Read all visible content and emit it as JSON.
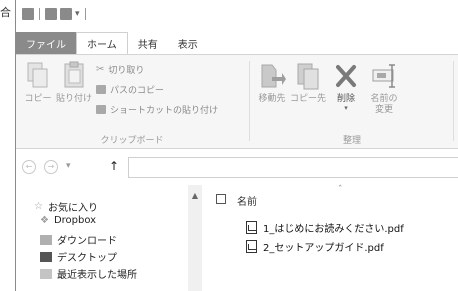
{
  "left_char": "合",
  "ribbon": {
    "tabs": {
      "file": "ファイル",
      "home": "ホーム",
      "share": "共有",
      "view": "表示"
    },
    "clipboard": {
      "copy": "コピー",
      "paste": "貼り付け",
      "cut": "切り取り",
      "copy_path": "パスのコピー",
      "paste_shortcut": "ショートカットの貼り付け",
      "group_label": "クリップボード"
    },
    "organize": {
      "move_to": "移動先",
      "copy_to": "コピー先",
      "delete": "削除",
      "rename_line1": "名前の",
      "rename_line2": "変更",
      "group_label": "整理"
    }
  },
  "nav_pane": {
    "items": [
      {
        "label": "お気に入り",
        "icon": "star-icon"
      },
      {
        "label": "Dropbox",
        "icon": "dropbox-icon"
      },
      {
        "label": "ダウンロード",
        "icon": "download-icon"
      },
      {
        "label": "デスクトップ",
        "icon": "desktop-icon"
      },
      {
        "label": "最近表示した場所",
        "icon": "recent-places-icon"
      }
    ]
  },
  "content": {
    "column_name": "名前",
    "files": [
      {
        "name": "1_はじめにお読みください.pdf",
        "icon": "pdf-file-icon"
      },
      {
        "name": "2_セットアップガイド.pdf",
        "icon": "pdf-file-icon"
      }
    ]
  }
}
